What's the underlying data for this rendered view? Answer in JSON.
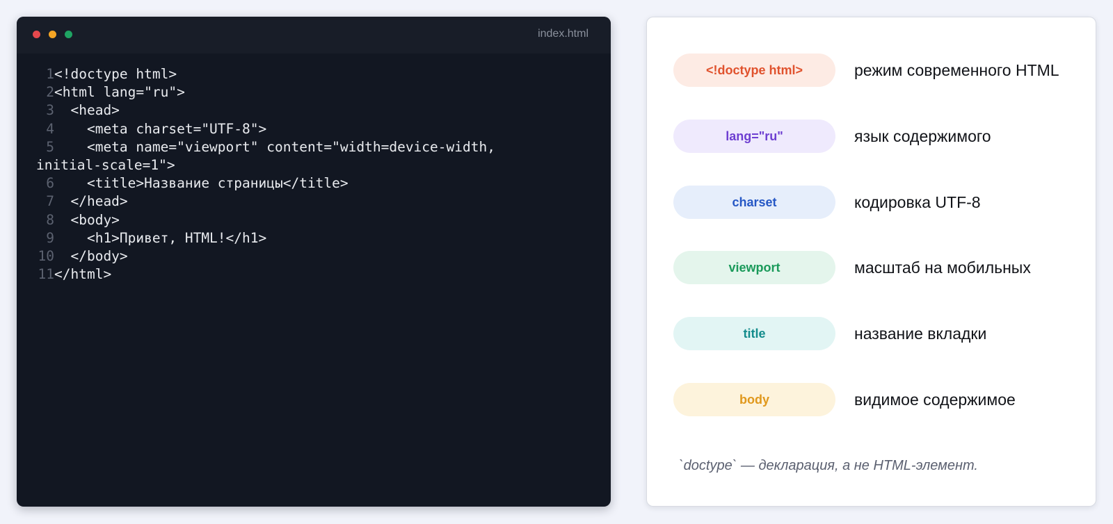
{
  "editor": {
    "filename": "index.html",
    "lines": [
      {
        "num": "1",
        "code": "<!doctype html>"
      },
      {
        "num": "2",
        "code": "<html lang=\"ru\">"
      },
      {
        "num": "3",
        "code": "  <head>"
      },
      {
        "num": "4",
        "code": "    <meta charset=\"UTF-8\">"
      },
      {
        "num": "5",
        "code": "    <meta name=\"viewport\" content=\"width=device-width,",
        "wrap": "initial-scale=1\">"
      },
      {
        "num": "6",
        "code": "    <title>Название страницы</title>"
      },
      {
        "num": "7",
        "code": "  </head>"
      },
      {
        "num": "8",
        "code": "  <body>"
      },
      {
        "num": "9",
        "code": "    <h1>Привет, HTML!</h1>"
      },
      {
        "num": "10",
        "code": "  </body>"
      },
      {
        "num": "11",
        "code": "</html>"
      }
    ],
    "dot_colors": {
      "red": "#e5484d",
      "yellow": "#f5a524",
      "green": "#1fa463"
    }
  },
  "legend": {
    "items": [
      {
        "tag": "<!doctype html>",
        "desc": "режим современного HTML",
        "color": "#e0522d",
        "bg": "#fdebe4"
      },
      {
        "tag": "lang=\"ru\"",
        "desc": "язык содержимого",
        "color": "#6e3fd1",
        "bg": "#efeafd"
      },
      {
        "tag": "charset",
        "desc": "кодировка UTF-8",
        "color": "#2557c5",
        "bg": "#e6eefb"
      },
      {
        "tag": "viewport",
        "desc": "масштаб на мобильных",
        "color": "#1a9a5a",
        "bg": "#e4f5ec"
      },
      {
        "tag": "title",
        "desc": "название вкладки",
        "color": "#138c8c",
        "bg": "#e2f5f4"
      },
      {
        "tag": "body",
        "desc": "видимое содержимое",
        "color": "#e0981c",
        "bg": "#fdf3dc"
      }
    ],
    "footnote": "`doctype` — декларация, а не HTML-элемент."
  }
}
